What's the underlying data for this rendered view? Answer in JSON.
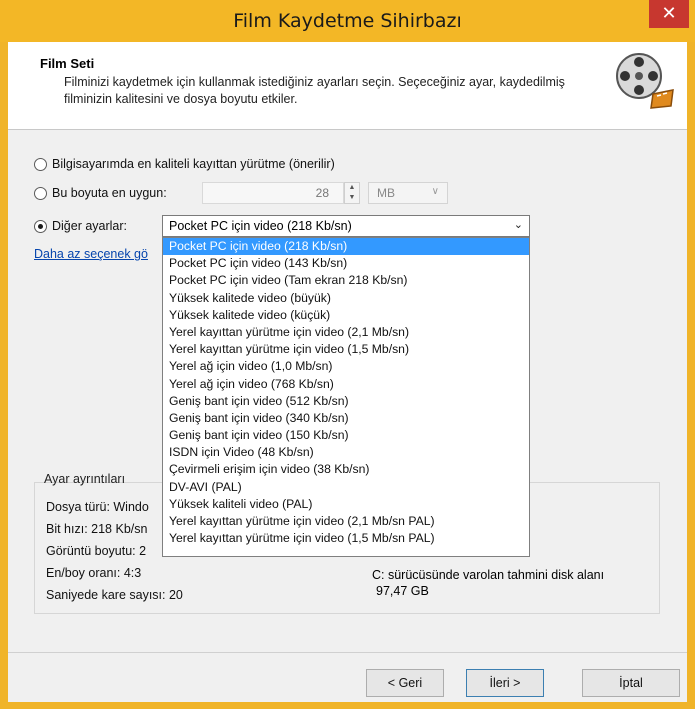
{
  "window": {
    "title": "Film Kaydetme Sihirbazı",
    "close_glyph": "✕"
  },
  "header": {
    "title": "Film Seti",
    "description": "Filminizi kaydetmek için kullanmak istediğiniz ayarları seçin. Seçeceğiniz ayar, kaydedilmiş filminizin kalitesini ve dosya boyutu etkiler.",
    "icon": "film-reel-icon"
  },
  "options": {
    "best_quality": "Bilgisayarımda en kaliteli kayıttan yürütme (önerilir)",
    "best_fit": "Bu boyuta en uygun:",
    "size_value": "28",
    "size_unit": "MB",
    "other": "Diğer ayarlar:",
    "selected_preset": "Pocket PC için video (218 Kb/sn)",
    "selected_option": "other"
  },
  "link_text": "Daha az seçenek gö",
  "presets": [
    "Pocket PC için video (218 Kb/sn)",
    "Pocket PC için video (143 Kb/sn)",
    "Pocket PC için video (Tam ekran 218 Kb/sn)",
    "Yüksek kalitede video (büyük)",
    "Yüksek kalitede video (küçük)",
    "Yerel kayıttan yürütme için video (2,1 Mb/sn)",
    "Yerel kayıttan yürütme için video (1,5 Mb/sn)",
    "Yerel ağ için video (1,0 Mb/sn)",
    "Yerel ağ için video (768 Kb/sn)",
    "Geniş bant için video (512 Kb/sn)",
    "Geniş bant için video (340 Kb/sn)",
    "Geniş bant için video (150 Kb/sn)",
    "ISDN için Video (48 Kb/sn)",
    "Çevirmeli erişim için video (38 Kb/sn)",
    "DV-AVI (PAL)",
    "Yüksek kaliteli video (PAL)",
    "Yerel kayıttan yürütme için video (2,1 Mb/sn PAL)",
    "Yerel kayıttan yürütme için video (1,5 Mb/sn PAL)"
  ],
  "details": {
    "label": "Ayar ayrıntıları",
    "file_type": "Dosya türü: Windo",
    "bit_rate": "Bit hızı: 218 Kb/sn",
    "display_size": "Görüntü boyutu: 2",
    "aspect_ratio": "En/boy oranı: 4:3",
    "frame_rate": "Saniyede kare sayısı: 20",
    "disk_label": "C: sürücüsünde varolan tahmini disk alanı",
    "disk_value": "97,47 GB"
  },
  "buttons": {
    "back": "< Geri",
    "next": "İleri >",
    "cancel": "İptal"
  },
  "colors": {
    "titlebar": "#f3b726",
    "close": "#c7372f",
    "selection": "#3399ff",
    "link": "#0645ad"
  }
}
